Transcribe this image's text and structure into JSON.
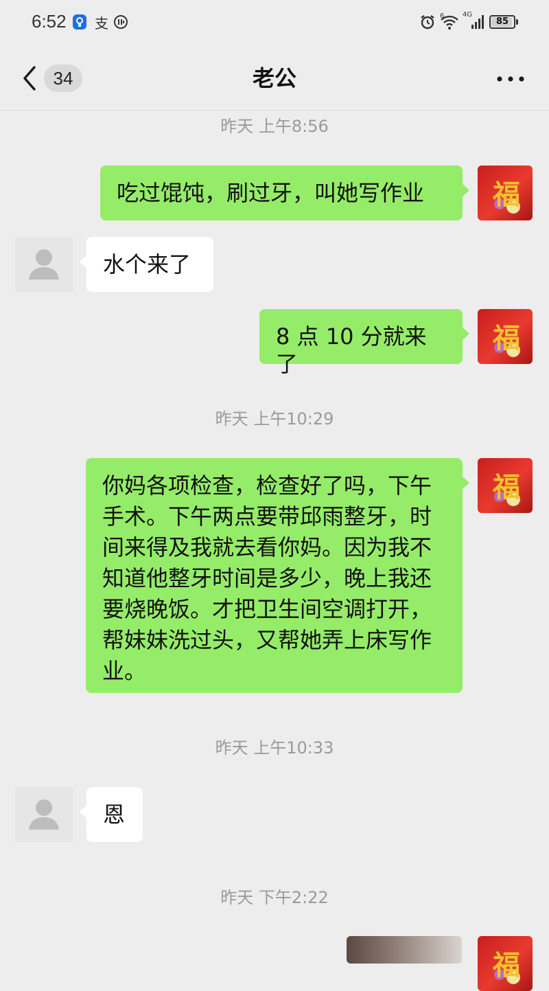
{
  "status_bar": {
    "time": "6:52",
    "battery": "85",
    "network": "4G",
    "sim": "6",
    "icons": [
      "shield-icon",
      "alipay-icon",
      "clock-app-icon",
      "alarm-icon",
      "wifi-icon",
      "signal-icon",
      "battery-icon"
    ]
  },
  "nav": {
    "title": "老公",
    "unread_count": "34",
    "icons": [
      "back-arrow-icon",
      "more-icon"
    ]
  },
  "messages": [
    {
      "type": "timestamp",
      "text": "昨天 上午8:56"
    },
    {
      "type": "message",
      "from": "me",
      "text": "吃过馄饨，刷过牙，叫她写作业"
    },
    {
      "type": "message",
      "from": "them",
      "text": "水个来了"
    },
    {
      "type": "message",
      "from": "me",
      "text": "8 点 10 分就来了"
    },
    {
      "type": "timestamp",
      "text": "昨天 上午10:29"
    },
    {
      "type": "message",
      "from": "me",
      "lines": [
        "你妈各项检查，检查好了吗，下午",
        "手术。下午两点要带邱雨整牙，时",
        "间来得及我就去看你妈。因为我不",
        "知道他整牙时间是多少，晚上我还",
        "要烧晚饭。才把卫生间空调打开，",
        "帮妹妹洗过头，又帮她弄上床写作",
        "业。"
      ]
    },
    {
      "type": "timestamp",
      "text": "昨天 上午10:33"
    },
    {
      "type": "message",
      "from": "them",
      "text": "恩"
    },
    {
      "type": "timestamp",
      "text": "昨天 下午2:22"
    },
    {
      "type": "message",
      "from": "me",
      "kind": "image"
    }
  ],
  "avatars": {
    "me": {
      "glyph": "福"
    }
  },
  "colors": {
    "background": "#ededed",
    "me_bubble": "#95ec69",
    "them_bubble": "#ffffff",
    "timestamp": "#9a9a9a"
  }
}
